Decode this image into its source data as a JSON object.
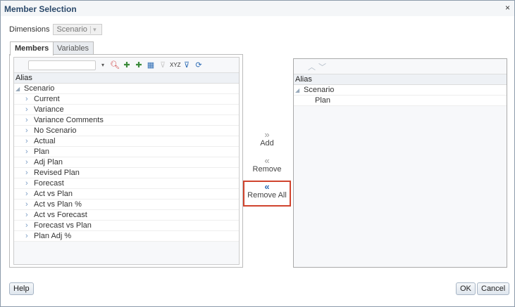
{
  "dialog": {
    "title": "Member Selection",
    "close": "×"
  },
  "dimensions": {
    "label": "Dimensions",
    "value": "Scenario"
  },
  "tabs": [
    {
      "label": "Members"
    },
    {
      "label": "Variables"
    }
  ],
  "left": {
    "search_placeholder": "",
    "column": "Alias",
    "root": "Scenario",
    "items": [
      "Current",
      "Variance",
      "Variance Comments",
      "No Scenario",
      "Actual",
      "Plan",
      "Adj Plan",
      "Revised Plan",
      "Forecast",
      "Act vs Plan",
      "Act vs Plan %",
      "Act vs Forecast",
      "Forecast vs Plan",
      "Plan Adj %"
    ]
  },
  "actions": {
    "add": "Add",
    "remove": "Remove",
    "remove_all": "Remove All"
  },
  "right": {
    "column": "Alias",
    "root": "Scenario",
    "items": [
      "Plan"
    ]
  },
  "buttons": {
    "help": "Help",
    "ok": "OK",
    "cancel": "Cancel"
  }
}
